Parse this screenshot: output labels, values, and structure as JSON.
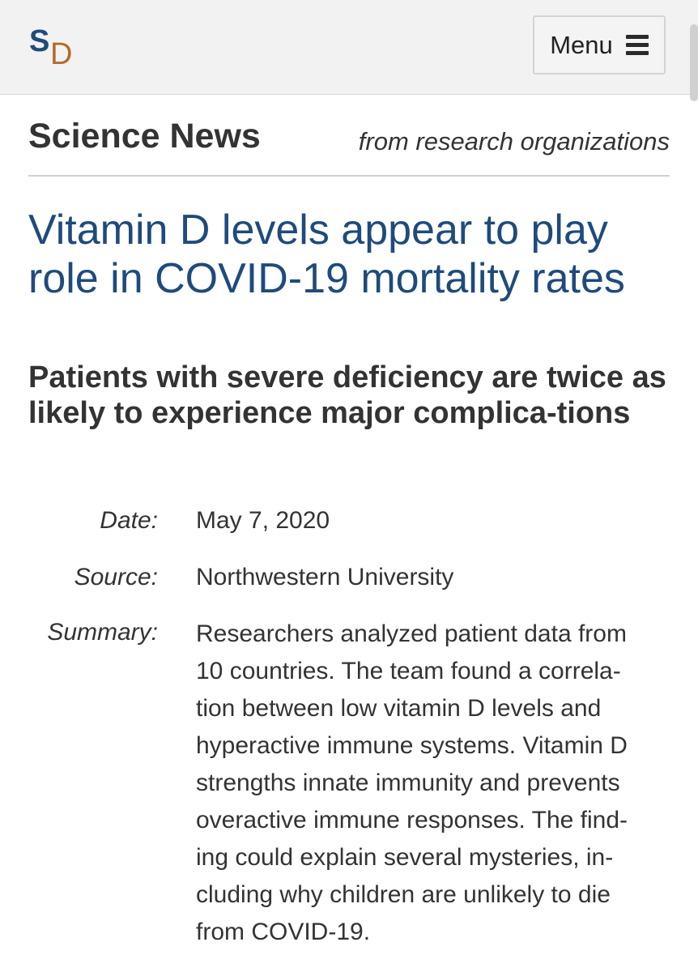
{
  "header": {
    "logo_letter_1": "S",
    "logo_letter_2": "D",
    "menu_label": "Menu"
  },
  "section": {
    "title": "Science News",
    "tagline": "from research organizations"
  },
  "article": {
    "headline": "Vitamin D levels appear to play role in COVID-19 mortality rates",
    "subheadline": "Patients with severe deficiency are twice as likely to experience major complica-tions",
    "meta": {
      "date_label": "Date:",
      "date_value": "May 7, 2020",
      "source_label": "Source:",
      "source_value": "Northwestern University",
      "summary_label": "Summary:",
      "summary_lines": [
        "Researchers analyzed patient data from",
        "10 countries. The team found a correla-",
        "tion between low vitamin D levels and",
        "hyperactive immune systems. Vitamin D",
        "strengths innate immunity and prevents",
        "overactive immune responses. The find-",
        "ing could explain several mysteries, in-",
        "cluding why children are unlikely to die",
        "from COVID-19."
      ]
    }
  },
  "colors": {
    "brand_blue": "#1f4a7c",
    "brand_orange": "#b56a2a",
    "topbar_bg": "#f2f2f2"
  }
}
